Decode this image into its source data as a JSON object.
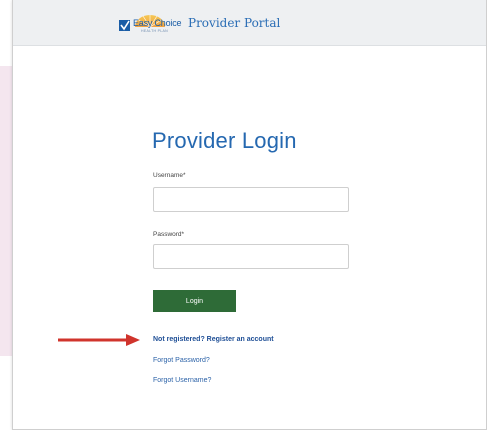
{
  "header": {
    "logo_text": "Easy Choice",
    "logo_subtext": "HEALTH PLAN",
    "portal_title": "Provider Portal"
  },
  "login": {
    "title": "Provider Login",
    "username_label": "Username*",
    "username_value": "",
    "password_label": "Password*",
    "password_value": "",
    "login_button": "Login"
  },
  "links": {
    "register": "Not registered? Register an account",
    "forgot_password": "Forgot Password?",
    "forgot_username": "Forgot Username?"
  },
  "colors": {
    "brand_blue": "#2568b0",
    "login_button": "#2e6b37",
    "annotation_arrow": "#d0342c"
  },
  "icons": {
    "logo": "easy-choice-checkmark-sunburst-logo",
    "annotation": "red-arrow-right"
  }
}
